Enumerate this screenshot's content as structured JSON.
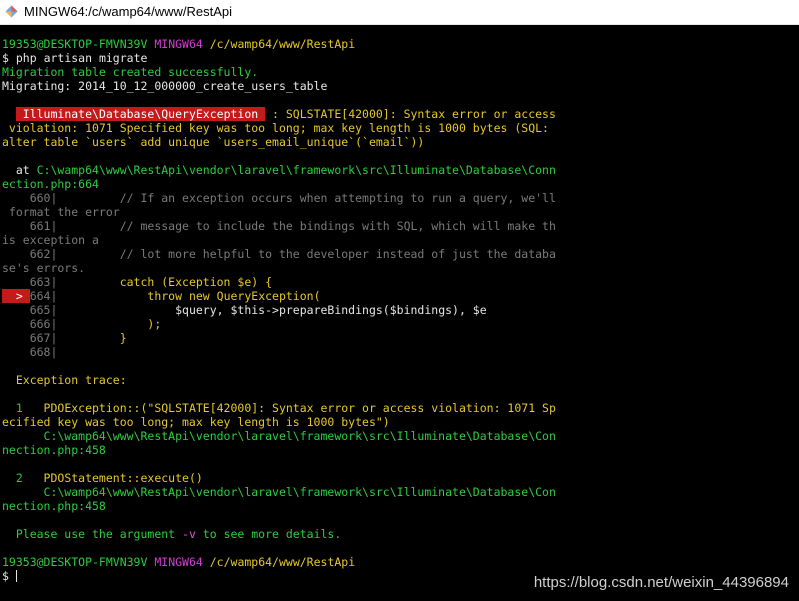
{
  "window": {
    "title": "MINGW64:/c/wamp64/www/RestApi"
  },
  "prompt": {
    "user_host": "19353@DESKTOP-FMVN39V",
    "env": "MINGW64",
    "path": "/c/wamp64/www/RestApi",
    "symbol": "$"
  },
  "lines": {
    "cmd": "php artisan migrate",
    "migration_created": "Migration table created successfully.",
    "migrating": "Migrating: 2014_10_12_000000_create_users_table",
    "exception_class": " Illuminate\\Database\\QueryException ",
    "error_part1": " : SQLSTATE[42000]: Syntax error or access",
    "error_part2": " violation: 1071 Specified key was too long; max key length is 1000 bytes (SQL:",
    "error_part3": "alter table `users` add unique `users_email_unique`(`email`))",
    "at_prefix": "  at ",
    "at_path1": "C:\\wamp64\\www\\RestApi\\vendor\\laravel\\framework\\src\\Illuminate\\Database\\Conn",
    "at_path2": "ection.php:664",
    "code_660_num": "    660|",
    "code_660_text": "         // If an exception occurs when attempting to run a query, we'll",
    "code_660_wrap": " format the error",
    "code_661_num": "    661|",
    "code_661_text": "         // message to include the bindings with SQL, which will make th",
    "code_661_wrap": "is exception a",
    "code_662_num": "    662|",
    "code_662_text": "         // lot more helpful to the developer instead of just the databa",
    "code_662_wrap": "se's errors.",
    "code_663_num": "    663|",
    "code_663_text": "         catch (Exception $e) {",
    "code_664_marker": "  > ",
    "code_664_num": "664|",
    "code_664_text": "             throw new QueryException(",
    "code_665_num": "    665|",
    "code_665_text": "                 $query, $this->prepareBindings($bindings), $e",
    "code_666_num": "    666|",
    "code_666_text": "             );",
    "code_667_num": "    667|",
    "code_667_text": "         }",
    "code_668_num": "    668|",
    "trace_header": "  Exception trace:",
    "trace1_num": "  1   ",
    "trace1_text": "PDOException::(\"SQLSTATE[42000]: Syntax error or access violation: 1071 Sp",
    "trace1_wrap": "ecified key was too long; max key length is 1000 bytes\")",
    "trace1_path1": "      C:\\wamp64\\www\\RestApi\\vendor\\laravel\\framework\\src\\Illuminate\\Database\\Con",
    "trace1_path2": "nection.php:458",
    "trace2_num": "  2   ",
    "trace2_text": "PDOStatement::execute()",
    "trace2_path1": "      C:\\wamp64\\www\\RestApi\\vendor\\laravel\\framework\\src\\Illuminate\\Database\\Con",
    "trace2_path2": "nection.php:458",
    "hint_prefix": "  Please use the argument ",
    "hint_flag": "-v",
    "hint_suffix": " to see more details."
  },
  "watermark": "https://blog.csdn.net/weixin_44396894",
  "colors": {
    "background": "#000000",
    "green": "#2ecc40",
    "yellow": "#e5c82b",
    "magenta": "#d13ed1",
    "red": "#c41a1a",
    "gray": "#7a7a7a"
  }
}
